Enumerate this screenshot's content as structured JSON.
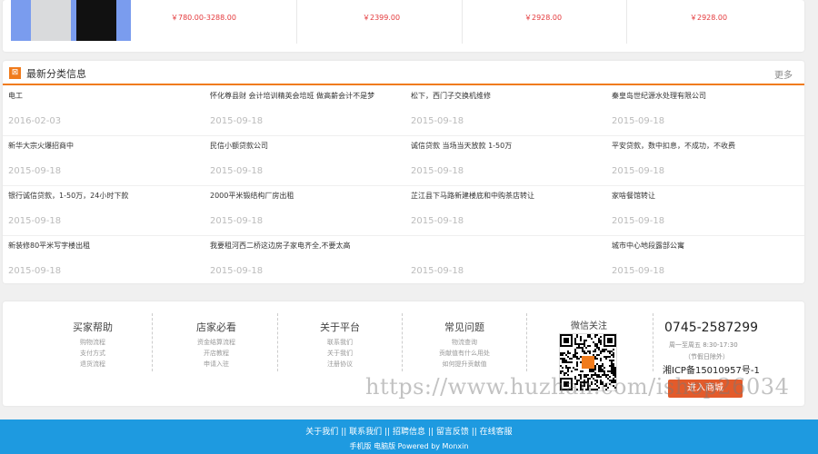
{
  "products": [
    {
      "name": "",
      "price": "￥780.00-3288.00"
    },
    {
      "name": "",
      "price": "￥2399.00"
    },
    {
      "name": "",
      "price": "￥2928.00"
    },
    {
      "name": "",
      "price": "￥2928.00"
    }
  ],
  "classified": {
    "title": "最新分类信息",
    "more": "更多",
    "icon": "grid-icon",
    "rows": [
      [
        {
          "title": "电工",
          "date": "2016-02-03"
        },
        {
          "title": "怀化尊县财 会计培训精英会培班 做高薪会计不是梦",
          "date": "2015-09-18"
        },
        {
          "title": "松下，西门子交换机维修",
          "date": "2015-09-18"
        },
        {
          "title": "秦皇岛世纪源水处理有限公司",
          "date": "2015-09-18"
        }
      ],
      [
        {
          "title": "新华大宗火爆招商中",
          "date": "2015-09-18"
        },
        {
          "title": "民信小额贷款公司",
          "date": "2015-09-18"
        },
        {
          "title": "诚信贷款 当场当天放款 1-50万",
          "date": "2015-09-18"
        },
        {
          "title": "平安贷款，数中扣息，不成功，不收费",
          "date": "2015-09-18"
        }
      ],
      [
        {
          "title": "银行诚信贷款，1-50万，24小时下款",
          "date": "2015-09-18"
        },
        {
          "title": "2000平米锻结构厂房出租",
          "date": "2015-09-18"
        },
        {
          "title": "芷江县下马路新建楼底和中购茶店转让",
          "date": "2015-09-18"
        },
        {
          "title": "家啥餐馆转让",
          "date": "2015-09-18"
        }
      ],
      [
        {
          "title": "新装修80平米写字楼出租",
          "date": "2015-09-18"
        },
        {
          "title": "我要租河西二桥这边房子家电齐全,不要太高",
          "date": "2015-09-18"
        },
        {
          "title": "",
          "date": "2015-09-18"
        },
        {
          "title": "城市中心地段露部公寓",
          "date": "2015-09-18"
        }
      ]
    ]
  },
  "help": [
    {
      "title": "买家帮助",
      "links": [
        "购物流程",
        "支付方式",
        "退货流程"
      ]
    },
    {
      "title": "店家必看",
      "links": [
        "资金结算流程",
        "开店教程",
        "申请入驻"
      ]
    },
    {
      "title": "关于平台",
      "links": [
        "联系我们",
        "关于我们",
        "注册协议"
      ]
    },
    {
      "title": "常见问题",
      "links": [
        "物流查询",
        "贡献值有什么用处",
        "如何提升贡献值"
      ]
    }
  ],
  "contact": {
    "wechat_title": "微信关注",
    "phone": "0745-2587299",
    "hours": "周一至周五 8:30-17:30",
    "hours_note": "（节假日除外）",
    "icp": "湘ICP备15010957号-1",
    "shop_button": "进入商城"
  },
  "watermark": "https://www.huzhan.com/ishop26034",
  "footer": {
    "links": [
      "关于我们",
      "联系我们",
      "招聘信息",
      "留言反馈",
      "在线客服"
    ],
    "separator": "||",
    "mobile": "手机版",
    "pc": "电脑版",
    "powered": "Powered by Monxin"
  },
  "colors": {
    "accent": "#f07b1c",
    "price": "#e4393c",
    "footer_bg": "#1e9ae0",
    "shop_button": "#e35b2b"
  }
}
